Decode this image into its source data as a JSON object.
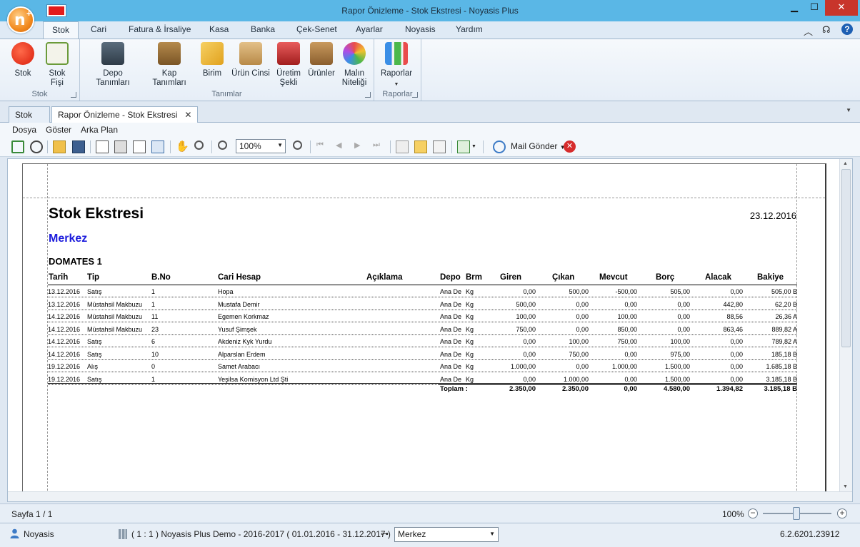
{
  "window": {
    "title": "Rapor Önizleme - Stok Ekstresi - Noyasis Plus"
  },
  "ribbon_tabs": [
    "Stok",
    "Cari",
    "Fatura & İrsaliye",
    "Kasa",
    "Banka",
    "Çek-Senet",
    "Ayarlar",
    "Noyasis",
    "Yardım"
  ],
  "ribbon": {
    "groups": {
      "stok": "Stok",
      "tanimlar": "Tanımlar",
      "raporlar": "Raporlar"
    },
    "buttons": {
      "stok": "Stok",
      "stok_fisi": "Stok Fişi",
      "depo": "Depo Tanımları",
      "kap": "Kap Tanımları",
      "birim": "Birim",
      "urun_cinsi": "Ürün Cinsi",
      "uretim_1": "Üretim",
      "uretim_2": "Şekli",
      "urunler": "Ürünler",
      "malin_1": "Malın",
      "malin_2": "Niteliği",
      "raporlar": "Raporlar"
    }
  },
  "doc_tabs": [
    "Stok",
    "Rapor Önizleme - Stok Ekstresi"
  ],
  "menu": [
    "Dosya",
    "Göster",
    "Arka Plan"
  ],
  "toolbar": {
    "zoom": "100%",
    "mail": "Mail Gönder"
  },
  "report": {
    "title": "Stok Ekstresi",
    "date": "23.12.2016",
    "branch": "Merkez",
    "product": "DOMATES 1",
    "columns": {
      "tarih": "Tarih",
      "tip": "Tip",
      "bno": "B.No",
      "cari": "Cari Hesap",
      "aciklama": "Açıklama",
      "depo": "Depo",
      "brm": "Brm",
      "giren": "Giren",
      "cikan": "Çıkan",
      "mevcut": "Mevcut",
      "borc": "Borç",
      "alacak": "Alacak",
      "bakiye": "Bakiye"
    },
    "rows": [
      {
        "tarih": "13.12.2016",
        "tip": "Satış",
        "bno": "1",
        "cari": "Hopa",
        "depo": "Ana De",
        "brm": "Kg",
        "giren": "0,00",
        "cikan": "500,00",
        "mevcut": "-500,00",
        "borc": "505,00",
        "alacak": "0,00",
        "bakiye": "505,00 B"
      },
      {
        "tarih": "13.12.2016",
        "tip": "Müstahsil Makbuzu",
        "bno": "1",
        "cari": "Mustafa Demir",
        "depo": "Ana De",
        "brm": "Kg",
        "giren": "500,00",
        "cikan": "0,00",
        "mevcut": "0,00",
        "borc": "0,00",
        "alacak": "442,80",
        "bakiye": "62,20 B"
      },
      {
        "tarih": "14.12.2016",
        "tip": "Müstahsil Makbuzu",
        "bno": "11",
        "cari": "Egemen Korkmaz",
        "depo": "Ana De",
        "brm": "Kg",
        "giren": "100,00",
        "cikan": "0,00",
        "mevcut": "100,00",
        "borc": "0,00",
        "alacak": "88,56",
        "bakiye": "26,36 A"
      },
      {
        "tarih": "14.12.2016",
        "tip": "Müstahsil Makbuzu",
        "bno": "23",
        "cari": "Yusuf Şimşek",
        "depo": "Ana De",
        "brm": "Kg",
        "giren": "750,00",
        "cikan": "0,00",
        "mevcut": "850,00",
        "borc": "0,00",
        "alacak": "863,46",
        "bakiye": "889,82 A"
      },
      {
        "tarih": "14.12.2016",
        "tip": "Satış",
        "bno": "6",
        "cari": "Akdeniz Kyk Yurdu",
        "depo": "Ana De",
        "brm": "Kg",
        "giren": "0,00",
        "cikan": "100,00",
        "mevcut": "750,00",
        "borc": "100,00",
        "alacak": "0,00",
        "bakiye": "789,82 A"
      },
      {
        "tarih": "14.12.2016",
        "tip": "Satış",
        "bno": "10",
        "cari": "Alparslan Erdem",
        "depo": "Ana De",
        "brm": "Kg",
        "giren": "0,00",
        "cikan": "750,00",
        "mevcut": "0,00",
        "borc": "975,00",
        "alacak": "0,00",
        "bakiye": "185,18 B"
      },
      {
        "tarih": "19.12.2016",
        "tip": "Alış",
        "bno": "0",
        "cari": "Samet Arabacı",
        "depo": "Ana De",
        "brm": "Kg",
        "giren": "1.000,00",
        "cikan": "0,00",
        "mevcut": "1.000,00",
        "borc": "1.500,00",
        "alacak": "0,00",
        "bakiye": "1.685,18 B"
      },
      {
        "tarih": "19.12.2016",
        "tip": "Satış",
        "bno": "1",
        "cari": "Yeşilsa Komisyon Ltd Şti",
        "depo": "Ana De",
        "brm": "Kg",
        "giren": "0,00",
        "cikan": "1.000,00",
        "mevcut": "0,00",
        "borc": "1.500,00",
        "alacak": "0,00",
        "bakiye": "3.185,18 B"
      }
    ],
    "totals": {
      "label": "Toplam  :",
      "giren": "2.350,00",
      "cikan": "2.350,00",
      "mevcut": "0,00",
      "borc": "4.580,00",
      "alacak": "1.394,82",
      "bakiye": "3.185,18 B"
    }
  },
  "status": {
    "page": "Sayfa 1 / 1",
    "zoom": "100%"
  },
  "bottom": {
    "user": "Noyasis",
    "company": "( 1 : 1 )  Noyasis Plus Demo - 2016-2017  ( 01.01.2016 - 31.12.2017 )",
    "branch": "Merkez",
    "version": "6.2.6201.23912"
  },
  "colors": {
    "titlebar": "#5ab7e6",
    "branch_text": "#1b1bdc",
    "close": "#c8352b"
  }
}
